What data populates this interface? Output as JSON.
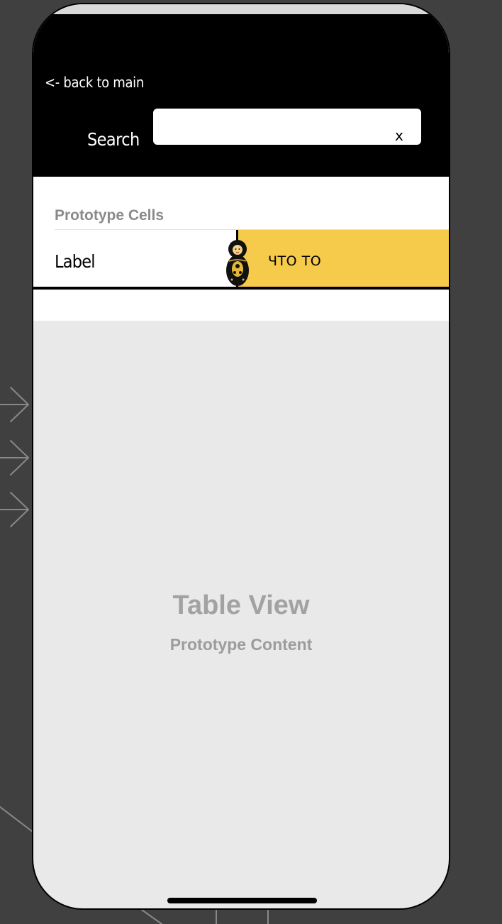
{
  "navbar": {
    "back_label": "<- back to main",
    "search_label": "Search",
    "search_value": "",
    "clear_label": "x"
  },
  "table": {
    "section_header": "Prototype Cells",
    "cell": {
      "label": "Label",
      "value": "ЧТО ТО",
      "image_icon": "matryoshka-doll-icon"
    }
  },
  "placeholder": {
    "title": "Table View",
    "subtitle": "Prototype Content"
  },
  "colors": {
    "canvas": "#404040",
    "navbar": "#000000",
    "cell_accent": "#f6cb4b",
    "table_background": "#e9e9e9"
  },
  "decor": {
    "segue_arrow_icon": "segue-arrow-icon"
  }
}
